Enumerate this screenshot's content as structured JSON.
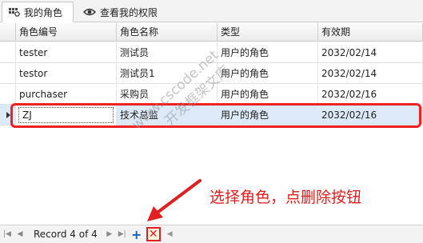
{
  "tabs": [
    {
      "label": "我的角色",
      "icon": "roles-grid-icon"
    },
    {
      "label": "查看我的权限",
      "icon": "eye-icon"
    }
  ],
  "grid": {
    "columns": [
      "角色编号",
      "角色名称",
      "类型",
      "有效期"
    ],
    "rows": [
      {
        "code": "tester",
        "name": "测试员",
        "type": "用户的角色",
        "expiry": "2032/02/14"
      },
      {
        "code": "testor",
        "name": "测试员1",
        "type": "用户的角色",
        "expiry": "2032/02/14"
      },
      {
        "code": "purchaser",
        "name": "采购员",
        "type": "用户的角色",
        "expiry": "2032/02/16"
      },
      {
        "code": "ZJ",
        "name": "技术总监",
        "type": "用户的角色",
        "expiry": "2032/02/16"
      }
    ],
    "selected_row": 4
  },
  "watermark": {
    "line1": "www.cscode.net",
    "line2": "开发框架文库"
  },
  "annotation": "选择角色，点删除按钮",
  "navigator": {
    "record_text": "Record 4 of 4",
    "first": "first-record-icon",
    "prev": "prev-record-icon",
    "next": "next-record-icon",
    "last": "last-record-icon",
    "add": "+",
    "delete": "✕"
  },
  "colors": {
    "highlight": "#ee2222",
    "annotation": "#e31b1b",
    "selection": "#dbe9f8",
    "add": "#1f5fbf"
  }
}
